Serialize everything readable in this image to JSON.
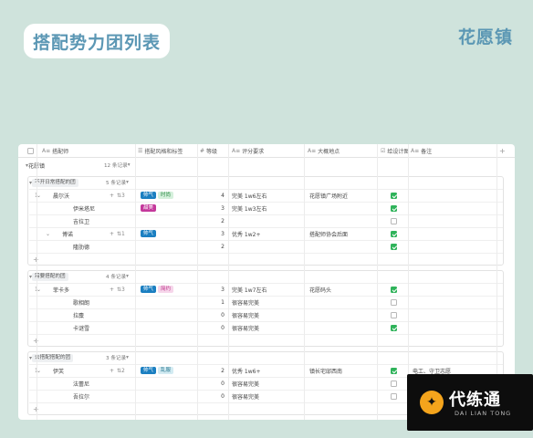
{
  "page_title": "搭配势力团列表",
  "brand_name": "花愿镇",
  "columns": {
    "name": "搭配师",
    "style": "搭配风格和标签",
    "level": "等级",
    "rating": "评分要求",
    "location": "大概地点",
    "plan": "给设计图",
    "note": "备注"
  },
  "top_group": {
    "label": "花愿镇",
    "count": "12 条记录"
  },
  "groups": [
    {
      "label": "不开日常搭配的团",
      "count": "5 条记录",
      "rows": [
        {
          "idx": "1",
          "name": "晨尔沃",
          "sub": "3",
          "tags": [
            "帅气",
            "时尚"
          ],
          "level": "4",
          "rating": "完美 1w6左右",
          "location": "花愿镇广场附近",
          "plan": true,
          "note": ""
        },
        {
          "idx": "",
          "name": "伊米塔尼",
          "sub": "",
          "tags": [
            "甜美"
          ],
          "level": "3",
          "rating": "完美 1w3左右",
          "location": "",
          "plan": true,
          "note": ""
        },
        {
          "idx": "",
          "name": "吉拉卫",
          "sub": "",
          "tags": [],
          "level": "2",
          "rating": "",
          "location": "",
          "plan": false,
          "note": ""
        },
        {
          "idx": "",
          "name": "博诺",
          "sub": "1",
          "tags": [
            "帅气"
          ],
          "level": "3",
          "rating": "优秀 1w2+",
          "location": "搭配师协会后面",
          "plan": true,
          "note": ""
        },
        {
          "idx": "",
          "name": "隆肋德",
          "sub": "",
          "tags": [],
          "level": "2",
          "rating": "",
          "location": "",
          "plan": true,
          "note": ""
        }
      ]
    },
    {
      "label": "需要搭配的团",
      "count": "4 条记录",
      "rows": [
        {
          "idx": "1",
          "name": "菲卡多",
          "sub": "3",
          "tags": [
            "帅气",
            "简约"
          ],
          "level": "3",
          "rating": "完美 1w7左右",
          "location": "花愿码头",
          "plan": true,
          "note": ""
        },
        {
          "idx": "",
          "name": "歌相朗",
          "sub": "",
          "tags": [],
          "level": "1",
          "rating": "很容易完美",
          "location": "",
          "plan": false,
          "note": ""
        },
        {
          "idx": "",
          "name": "拉麋",
          "sub": "",
          "tags": [],
          "level": "0",
          "rating": "很容易完美",
          "location": "",
          "plan": false,
          "note": ""
        },
        {
          "idx": "",
          "name": "卡谜雪",
          "sub": "",
          "tags": [],
          "level": "0",
          "rating": "很容易完美",
          "location": "",
          "plan": true,
          "note": ""
        }
      ]
    },
    {
      "label": "去搭配搭配的团",
      "count": "3 条记录",
      "rows": [
        {
          "idx": "1",
          "name": "伊芙",
          "sub": "2",
          "tags": [
            "帅气",
            "乱服"
          ],
          "level": "2",
          "rating": "优秀 1w6+",
          "location": "镇长宅邸西南",
          "plan": true,
          "note": "电工、守卫志愿"
        },
        {
          "idx": "",
          "name": "法蕾尼",
          "sub": "",
          "tags": [],
          "level": "0",
          "rating": "很容易完美",
          "location": "",
          "plan": false,
          "note": ""
        },
        {
          "idx": "",
          "name": "吾拉尔",
          "sub": "",
          "tags": [],
          "level": "0",
          "rating": "很容易完美",
          "location": "",
          "plan": false,
          "note": ""
        }
      ]
    }
  ],
  "logo": {
    "main": "代练通",
    "sub": "DAI LIAN TONG"
  }
}
